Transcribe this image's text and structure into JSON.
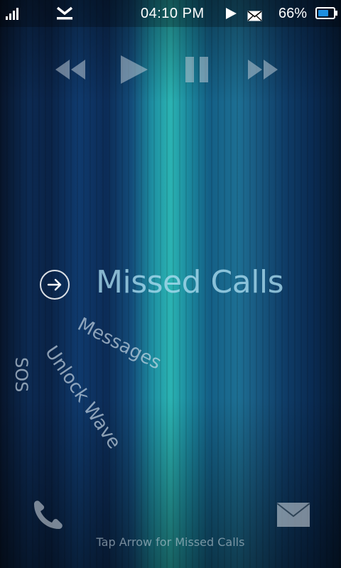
{
  "status_bar": {
    "time": "04:10 PM",
    "battery_percent": "66%",
    "battery_level": 0.66,
    "icons": [
      "signal-icon",
      "download-icon",
      "play-icon",
      "mail-icon",
      "battery-icon"
    ]
  },
  "media_controls": {
    "icons": [
      "rewind-icon",
      "play-icon",
      "pause-icon",
      "fast-forward-icon"
    ]
  },
  "lock": {
    "title": "Missed Calls",
    "arrow_icon": "arrow-right-circle-icon",
    "curved_labels": {
      "messages": "Messages",
      "unlock": "Unlock Wave",
      "sos": "SOS"
    },
    "hint": "Tap Arrow for Missed Calls"
  },
  "bottom": {
    "left_icon": "phone-icon",
    "right_icon": "mail-icon"
  },
  "colors": {
    "accent": "#2bb3b2",
    "battery_fill": "#1d8fe0"
  }
}
